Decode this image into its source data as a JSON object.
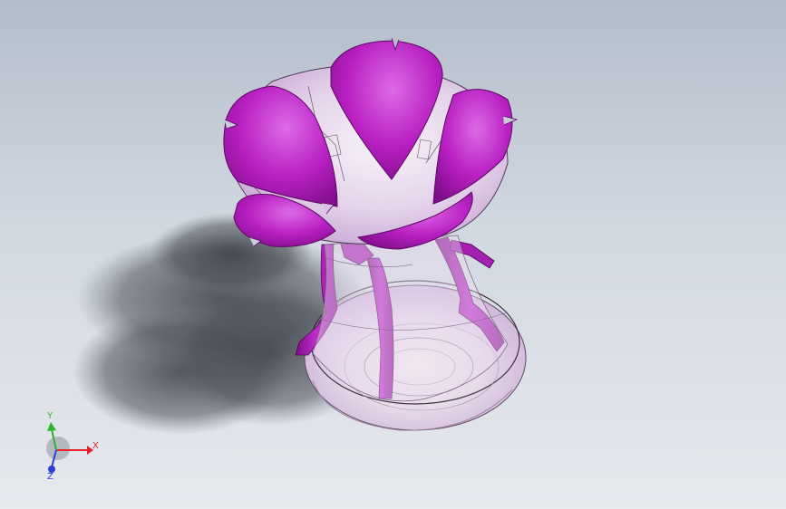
{
  "viewport": {
    "background_top": "#b3bdcb",
    "background_bottom": "#e6e9ee",
    "part_color": "#b51fbf",
    "part_highlight": "#d65ee0",
    "glass_color": "#d9bfe3"
  },
  "triad": {
    "x_label": "X",
    "y_label": "Y",
    "z_label": "Z",
    "x_color": "#e8202a",
    "y_color": "#2db32d",
    "z_color": "#2a3fd8"
  }
}
